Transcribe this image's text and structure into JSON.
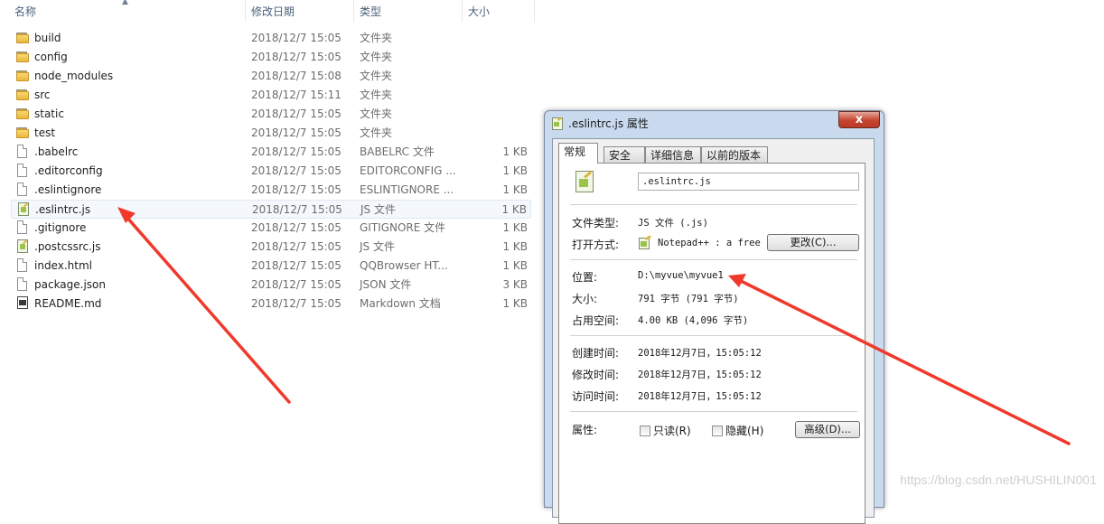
{
  "explorer": {
    "columns": {
      "name": "名称",
      "date": "修改日期",
      "type": "类型",
      "size": "大小"
    },
    "files": [
      {
        "name": "build",
        "date": "2018/12/7 15:05",
        "type": "文件夹",
        "size": "",
        "icon": "folder-icon"
      },
      {
        "name": "config",
        "date": "2018/12/7 15:05",
        "type": "文件夹",
        "size": "",
        "icon": "folder-icon"
      },
      {
        "name": "node_modules",
        "date": "2018/12/7 15:08",
        "type": "文件夹",
        "size": "",
        "icon": "folder-icon"
      },
      {
        "name": "src",
        "date": "2018/12/7 15:11",
        "type": "文件夹",
        "size": "",
        "icon": "folder-icon"
      },
      {
        "name": "static",
        "date": "2018/12/7 15:05",
        "type": "文件夹",
        "size": "",
        "icon": "folder-icon"
      },
      {
        "name": "test",
        "date": "2018/12/7 15:05",
        "type": "文件夹",
        "size": "",
        "icon": "folder-icon"
      },
      {
        "name": ".babelrc",
        "date": "2018/12/7 15:05",
        "type": "BABELRC 文件",
        "size": "1 KB",
        "icon": "file-icon"
      },
      {
        "name": ".editorconfig",
        "date": "2018/12/7 15:05",
        "type": "EDITORCONFIG ...",
        "size": "1 KB",
        "icon": "file-icon"
      },
      {
        "name": ".eslintignore",
        "date": "2018/12/7 15:05",
        "type": "ESLINTIGNORE ...",
        "size": "1 KB",
        "icon": "file-icon"
      },
      {
        "name": ".eslintrc.js",
        "date": "2018/12/7 15:05",
        "type": "JS 文件",
        "size": "1 KB",
        "icon": "notepad-file-icon",
        "selected": true
      },
      {
        "name": ".gitignore",
        "date": "2018/12/7 15:05",
        "type": "GITIGNORE 文件",
        "size": "1 KB",
        "icon": "file-icon"
      },
      {
        "name": ".postcssrc.js",
        "date": "2018/12/7 15:05",
        "type": "JS 文件",
        "size": "1 KB",
        "icon": "notepad-file-icon"
      },
      {
        "name": "index.html",
        "date": "2018/12/7 15:05",
        "type": "QQBrowser HT...",
        "size": "1 KB",
        "icon": "file-icon"
      },
      {
        "name": "package.json",
        "date": "2018/12/7 15:05",
        "type": "JSON 文件",
        "size": "3 KB",
        "icon": "file-icon"
      },
      {
        "name": "README.md",
        "date": "2018/12/7 15:05",
        "type": "Markdown 文档",
        "size": "1 KB",
        "icon": "markdown-file-icon"
      }
    ]
  },
  "dialog": {
    "title": ".eslintrc.js 属性",
    "close": "x",
    "tabs": [
      "常规",
      "安全",
      "详细信息",
      "以前的版本"
    ],
    "filename": ".eslintrc.js",
    "file_type_label": "文件类型:",
    "file_type_value": "JS 文件 (.js)",
    "open_with_label": "打开方式:",
    "open_with_value": "Notepad++ : a free",
    "change_button": "更改(C)...",
    "location_label": "位置:",
    "location_value": "D:\\myvue\\myvue1",
    "size_label": "大小:",
    "size_value": "791 字节 (791 字节)",
    "disk_size_label": "占用空间:",
    "disk_size_value": "4.00 KB (4,096 字节)",
    "created_label": "创建时间:",
    "created_value": "2018年12月7日，15:05:12",
    "modified_label": "修改时间:",
    "modified_value": "2018年12月7日，15:05:12",
    "accessed_label": "访问时间:",
    "accessed_value": "2018年12月7日，15:05:12",
    "attributes_label": "属性:",
    "readonly_label": "只读(R)",
    "hidden_label": "隐藏(H)",
    "advanced_button": "高级(D)..."
  },
  "watermark": "https://blog.csdn.net/HUSHILIN001",
  "colors": {
    "arrow": "#f0392b",
    "selection": "#f4f8fd",
    "dialog_frame": "#c9daef"
  }
}
